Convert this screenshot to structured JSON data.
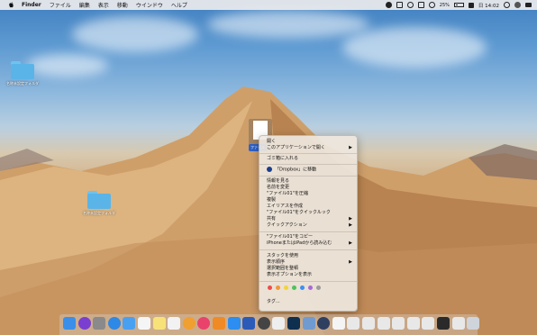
{
  "menubar": {
    "app_name": "Finder",
    "menus": [
      "ファイル",
      "編集",
      "表示",
      "移動",
      "ウインドウ",
      "ヘルプ"
    ],
    "battery": "25%",
    "clock": "日 14:02"
  },
  "desktop": {
    "icons": [
      {
        "label": "名称未設定フォルダ"
      },
      {
        "label": "名称未設定フォルダ"
      },
      {
        "label": "ファイル"
      }
    ]
  },
  "context_menu": {
    "items": [
      {
        "label": "開く"
      },
      {
        "label": "このアプリケーションで開く"
      },
      {
        "label": "ゴミ箱に入れる"
      },
      {
        "label": "「Dropbox」に移動"
      },
      {
        "label": "情報を見る"
      },
      {
        "label": "名前を変更"
      },
      {
        "label": "\"ファイル01\"を圧縮"
      },
      {
        "label": "複製"
      },
      {
        "label": "エイリアスを作成"
      },
      {
        "label": "\"ファイル01\"をクイックルック"
      },
      {
        "label": "共有"
      },
      {
        "label": "クイックアクション"
      },
      {
        "label": "\"ファイル01\"をコピー"
      },
      {
        "label": "iPhoneまたはiPadから読み込む"
      },
      {
        "label": "スタックを使用"
      },
      {
        "label": "表示順序"
      },
      {
        "label": "選択範囲を整頓"
      },
      {
        "label": "表示オプションを表示"
      },
      {
        "label": "タグ..."
      }
    ],
    "tag_colors": [
      "#ef4b4b",
      "#f0983a",
      "#f2d33a",
      "#4cc35a",
      "#3c8ef0",
      "#a869d8",
      "#9c9c9c"
    ]
  },
  "dock": {
    "apps": [
      {
        "icon": "finder-icon",
        "color": "#3b8fe8"
      },
      {
        "icon": "siri-icon",
        "color": "#7a3fd0"
      },
      {
        "icon": "launchpad-icon",
        "color": "#8a8a8a"
      },
      {
        "icon": "safari-icon",
        "color": "#2d89e5"
      },
      {
        "icon": "mail-icon",
        "color": "#4aa0f0"
      },
      {
        "icon": "calendar-icon",
        "color": "#f5f5f5"
      },
      {
        "icon": "notes-icon",
        "color": "#f7e27a"
      },
      {
        "icon": "reminders-icon",
        "color": "#f2f2f2"
      },
      {
        "icon": "photos-icon",
        "color": "#f0a030"
      },
      {
        "icon": "itunes-icon",
        "color": "#e9436b"
      },
      {
        "icon": "books-icon",
        "color": "#f08a24"
      },
      {
        "icon": "appstore-icon",
        "color": "#2b8ef0"
      },
      {
        "icon": "word-icon",
        "color": "#2b5bb8"
      },
      {
        "icon": "timemachine-icon",
        "color": "#444444"
      },
      {
        "icon": "textedit-icon",
        "color": "#eeeeee"
      },
      {
        "icon": "photoshop-icon",
        "color": "#0f2f4f"
      },
      {
        "icon": "preview-icon",
        "color": "#6f9bd0"
      },
      {
        "icon": "quicktime-icon",
        "color": "#2f3f5f"
      },
      {
        "icon": "document-icon",
        "color": "#f4f4f4"
      },
      {
        "icon": "screenshot-icon",
        "color": "#e8e8e8"
      },
      {
        "icon": "screenshot-icon",
        "color": "#e8e8e8"
      },
      {
        "icon": "screenshot-icon",
        "color": "#e8e8e8"
      },
      {
        "icon": "screenshot-icon",
        "color": "#e8e8e8"
      },
      {
        "icon": "screenshot-icon",
        "color": "#e8e8e8"
      },
      {
        "icon": "screenshot-icon",
        "color": "#e8e8e8"
      },
      {
        "icon": "screenshot-icon",
        "color": "#2a2a2a"
      },
      {
        "icon": "screenshot-icon",
        "color": "#e8e8e8"
      },
      {
        "icon": "trash-icon",
        "color": "#cfd4da"
      }
    ]
  }
}
